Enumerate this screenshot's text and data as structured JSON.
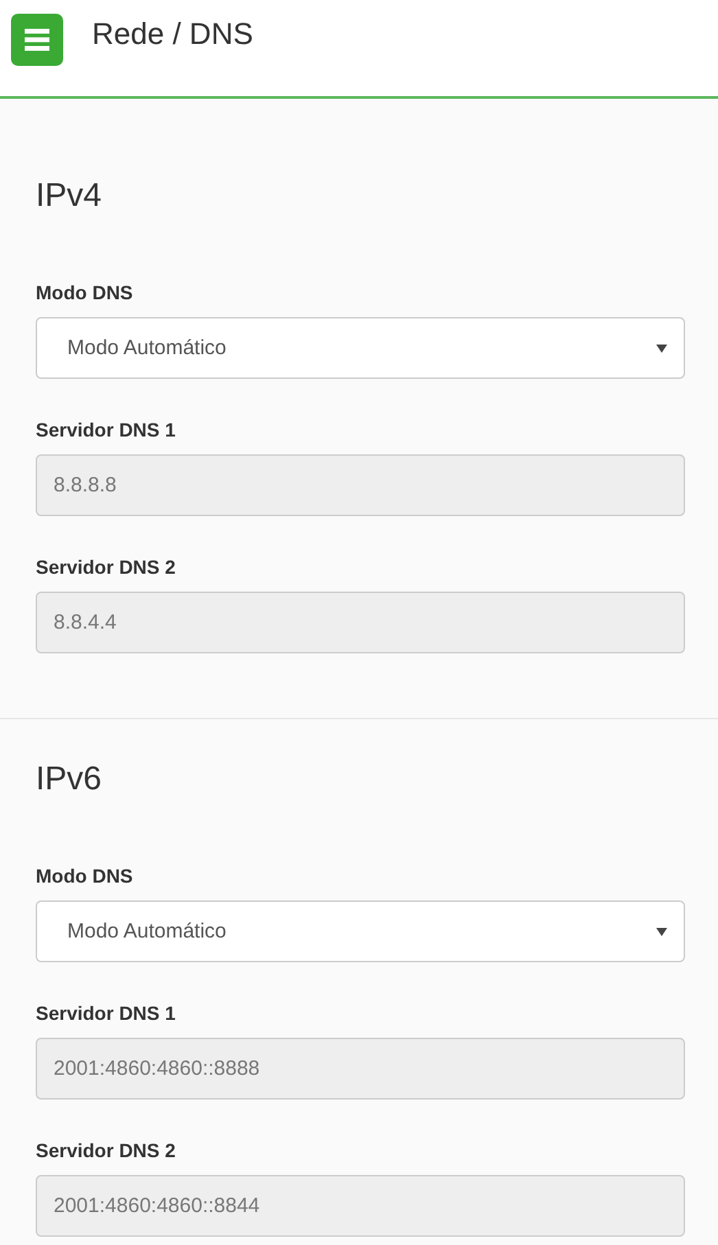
{
  "header": {
    "title": "Rede / DNS"
  },
  "sections": [
    {
      "heading": "IPv4",
      "fields": [
        {
          "kind": "select",
          "label": "Modo DNS",
          "value": "Modo Automático",
          "disabled": false
        },
        {
          "kind": "input",
          "label": "Servidor DNS 1",
          "value": "8.8.8.8",
          "disabled": true
        },
        {
          "kind": "input",
          "label": "Servidor DNS 2",
          "value": "8.8.4.4",
          "disabled": true
        }
      ]
    },
    {
      "heading": "IPv6",
      "fields": [
        {
          "kind": "select",
          "label": "Modo DNS",
          "value": "Modo Automático",
          "disabled": false
        },
        {
          "kind": "input",
          "label": "Servidor DNS 1",
          "value": "2001:4860:4860::8888",
          "disabled": true
        },
        {
          "kind": "input",
          "label": "Servidor DNS 2",
          "value": "2001:4860:4860::8844",
          "disabled": true
        }
      ]
    }
  ]
}
